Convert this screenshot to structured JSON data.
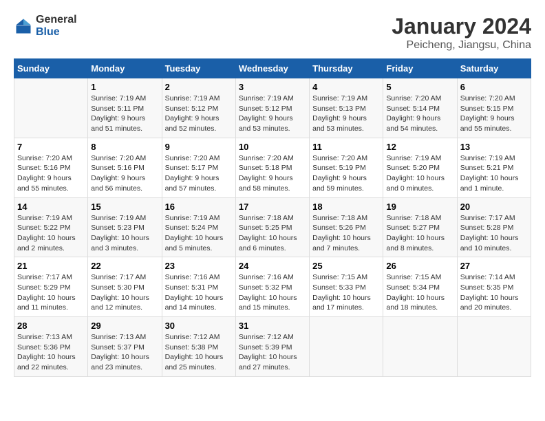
{
  "logo": {
    "general": "General",
    "blue": "Blue"
  },
  "title": "January 2024",
  "subtitle": "Peicheng, Jiangsu, China",
  "days_header": [
    "Sunday",
    "Monday",
    "Tuesday",
    "Wednesday",
    "Thursday",
    "Friday",
    "Saturday"
  ],
  "weeks": [
    [
      {
        "day": "",
        "info": ""
      },
      {
        "day": "1",
        "info": "Sunrise: 7:19 AM\nSunset: 5:11 PM\nDaylight: 9 hours\nand 51 minutes."
      },
      {
        "day": "2",
        "info": "Sunrise: 7:19 AM\nSunset: 5:12 PM\nDaylight: 9 hours\nand 52 minutes."
      },
      {
        "day": "3",
        "info": "Sunrise: 7:19 AM\nSunset: 5:12 PM\nDaylight: 9 hours\nand 53 minutes."
      },
      {
        "day": "4",
        "info": "Sunrise: 7:19 AM\nSunset: 5:13 PM\nDaylight: 9 hours\nand 53 minutes."
      },
      {
        "day": "5",
        "info": "Sunrise: 7:20 AM\nSunset: 5:14 PM\nDaylight: 9 hours\nand 54 minutes."
      },
      {
        "day": "6",
        "info": "Sunrise: 7:20 AM\nSunset: 5:15 PM\nDaylight: 9 hours\nand 55 minutes."
      }
    ],
    [
      {
        "day": "7",
        "info": "Sunrise: 7:20 AM\nSunset: 5:16 PM\nDaylight: 9 hours\nand 55 minutes."
      },
      {
        "day": "8",
        "info": "Sunrise: 7:20 AM\nSunset: 5:16 PM\nDaylight: 9 hours\nand 56 minutes."
      },
      {
        "day": "9",
        "info": "Sunrise: 7:20 AM\nSunset: 5:17 PM\nDaylight: 9 hours\nand 57 minutes."
      },
      {
        "day": "10",
        "info": "Sunrise: 7:20 AM\nSunset: 5:18 PM\nDaylight: 9 hours\nand 58 minutes."
      },
      {
        "day": "11",
        "info": "Sunrise: 7:20 AM\nSunset: 5:19 PM\nDaylight: 9 hours\nand 59 minutes."
      },
      {
        "day": "12",
        "info": "Sunrise: 7:19 AM\nSunset: 5:20 PM\nDaylight: 10 hours\nand 0 minutes."
      },
      {
        "day": "13",
        "info": "Sunrise: 7:19 AM\nSunset: 5:21 PM\nDaylight: 10 hours\nand 1 minute."
      }
    ],
    [
      {
        "day": "14",
        "info": "Sunrise: 7:19 AM\nSunset: 5:22 PM\nDaylight: 10 hours\nand 2 minutes."
      },
      {
        "day": "15",
        "info": "Sunrise: 7:19 AM\nSunset: 5:23 PM\nDaylight: 10 hours\nand 3 minutes."
      },
      {
        "day": "16",
        "info": "Sunrise: 7:19 AM\nSunset: 5:24 PM\nDaylight: 10 hours\nand 5 minutes."
      },
      {
        "day": "17",
        "info": "Sunrise: 7:18 AM\nSunset: 5:25 PM\nDaylight: 10 hours\nand 6 minutes."
      },
      {
        "day": "18",
        "info": "Sunrise: 7:18 AM\nSunset: 5:26 PM\nDaylight: 10 hours\nand 7 minutes."
      },
      {
        "day": "19",
        "info": "Sunrise: 7:18 AM\nSunset: 5:27 PM\nDaylight: 10 hours\nand 8 minutes."
      },
      {
        "day": "20",
        "info": "Sunrise: 7:17 AM\nSunset: 5:28 PM\nDaylight: 10 hours\nand 10 minutes."
      }
    ],
    [
      {
        "day": "21",
        "info": "Sunrise: 7:17 AM\nSunset: 5:29 PM\nDaylight: 10 hours\nand 11 minutes."
      },
      {
        "day": "22",
        "info": "Sunrise: 7:17 AM\nSunset: 5:30 PM\nDaylight: 10 hours\nand 12 minutes."
      },
      {
        "day": "23",
        "info": "Sunrise: 7:16 AM\nSunset: 5:31 PM\nDaylight: 10 hours\nand 14 minutes."
      },
      {
        "day": "24",
        "info": "Sunrise: 7:16 AM\nSunset: 5:32 PM\nDaylight: 10 hours\nand 15 minutes."
      },
      {
        "day": "25",
        "info": "Sunrise: 7:15 AM\nSunset: 5:33 PM\nDaylight: 10 hours\nand 17 minutes."
      },
      {
        "day": "26",
        "info": "Sunrise: 7:15 AM\nSunset: 5:34 PM\nDaylight: 10 hours\nand 18 minutes."
      },
      {
        "day": "27",
        "info": "Sunrise: 7:14 AM\nSunset: 5:35 PM\nDaylight: 10 hours\nand 20 minutes."
      }
    ],
    [
      {
        "day": "28",
        "info": "Sunrise: 7:13 AM\nSunset: 5:36 PM\nDaylight: 10 hours\nand 22 minutes."
      },
      {
        "day": "29",
        "info": "Sunrise: 7:13 AM\nSunset: 5:37 PM\nDaylight: 10 hours\nand 23 minutes."
      },
      {
        "day": "30",
        "info": "Sunrise: 7:12 AM\nSunset: 5:38 PM\nDaylight: 10 hours\nand 25 minutes."
      },
      {
        "day": "31",
        "info": "Sunrise: 7:12 AM\nSunset: 5:39 PM\nDaylight: 10 hours\nand 27 minutes."
      },
      {
        "day": "",
        "info": ""
      },
      {
        "day": "",
        "info": ""
      },
      {
        "day": "",
        "info": ""
      }
    ]
  ]
}
